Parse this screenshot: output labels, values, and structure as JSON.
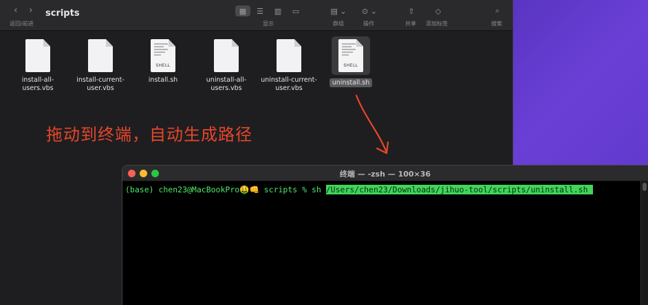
{
  "finder": {
    "title": "scripts",
    "nav_caption": "返回/前进",
    "toolbar": {
      "view_caption": "显示",
      "group_caption": "群组",
      "action_caption": "操作",
      "share_caption": "共享",
      "tag_caption": "添加标签",
      "search_caption": "搜索"
    },
    "files": [
      {
        "line1": "install-all-",
        "line2": "users.vbs",
        "type": "vbs"
      },
      {
        "line1": "install-current-",
        "line2": "user.vbs",
        "type": "vbs"
      },
      {
        "line1": "install.sh",
        "line2": "",
        "type": "shell"
      },
      {
        "line1": "uninstall-all-",
        "line2": "users.vbs",
        "type": "vbs"
      },
      {
        "line1": "uninstall-current-",
        "line2": "user.vbs",
        "type": "vbs"
      },
      {
        "line1": "uninstall.sh",
        "line2": "",
        "type": "shell",
        "selected": true
      }
    ],
    "shell_label": "SHELL"
  },
  "annotation": {
    "text": "拖动到终端，自动生成路径",
    "color": "#e8462b"
  },
  "terminal": {
    "title": "终端 — -zsh — 100×36",
    "prompt": "(base) chen23@MacBookPro🤑👊 scripts % sh ",
    "path": "/Users/chen23/Downloads/jihuo-tool/scripts/uninstall.sh"
  },
  "colors": {
    "terminal_text": "#4ee86a",
    "path_highlight": "#3fd65a",
    "desktop_accent": "#4b2bb0"
  }
}
